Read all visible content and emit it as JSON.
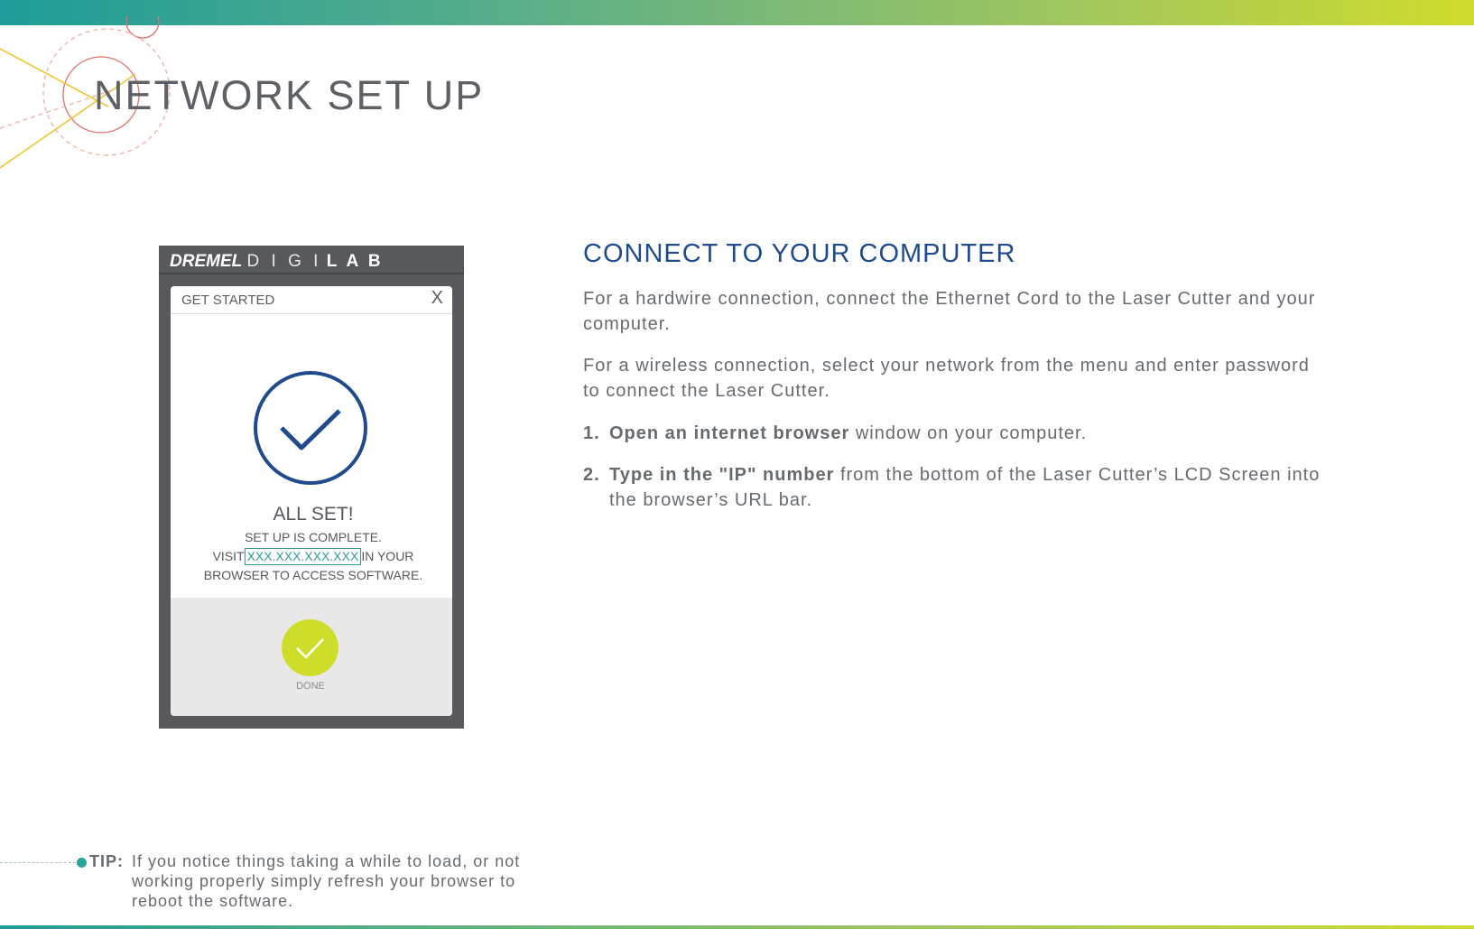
{
  "page": {
    "title": "NETWORK SET UP"
  },
  "device": {
    "brand_bold": "DREMEL",
    "brand_digi": "D I G I",
    "brand_lab": "L A B",
    "dialog_title": "GET STARTED",
    "close_label": "X",
    "heading": "ALL SET!",
    "line1": "SET UP IS COMPLETE.",
    "visit_prefix": "VISIT",
    "ip_placeholder": "XXX.XXX.XXX.XXX",
    "visit_suffix": "IN YOUR",
    "line3": "BROWSER TO ACCESS SOFTWARE.",
    "done_label": "DONE"
  },
  "section": {
    "title": "CONNECT TO YOUR COMPUTER",
    "para1": "For a hardwire connection, connect the Ethernet Cord to the Laser Cutter and your computer.",
    "para2": "For a wireless connection, select your network from the menu and enter password to connect the Laser Cutter.",
    "steps": [
      {
        "num": "1.",
        "bold": "Open an internet browser",
        "rest": " window on your computer."
      },
      {
        "num": "2.",
        "bold": "Type in the \"IP\" number",
        "rest": " from the bottom of the Laser Cutter’s LCD Screen into the browser’s URL bar."
      }
    ]
  },
  "tip": {
    "label": "TIP:",
    "text": "If you notice things taking a while to load, or not working properly simply refresh your browser to reboot the software."
  },
  "colors": {
    "accent_blue": "#1f4a8c",
    "accent_teal": "#2aa39d",
    "accent_lime": "#cedd2a",
    "device_gray": "#57595c"
  },
  "icons": [
    "check-circle-icon",
    "done-check-icon",
    "tip-bullet-icon"
  ]
}
